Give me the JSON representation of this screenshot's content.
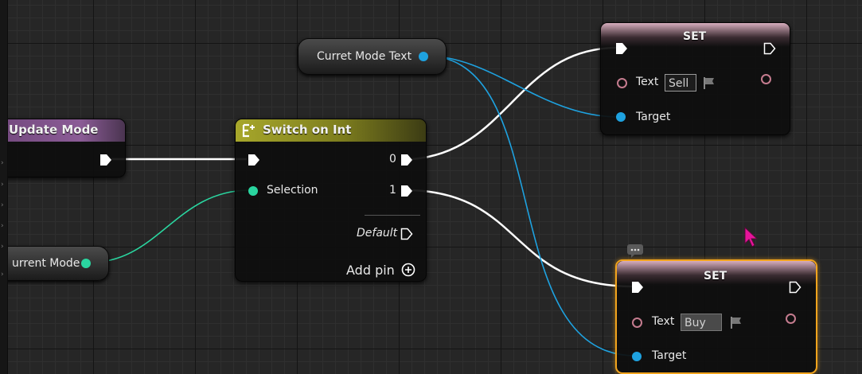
{
  "events": {
    "update_mode": {
      "title": "Update Mode"
    }
  },
  "variables": {
    "current_mode_text": {
      "label": "Curret Mode Text"
    },
    "current_mode": {
      "label": "urrent Mode"
    }
  },
  "switch_node": {
    "title": "Switch on Int",
    "selection_label": "Selection",
    "out_0": "0",
    "out_1": "1",
    "default_label": "Default",
    "add_pin_label": "Add pin"
  },
  "set_nodes": [
    {
      "title": "SET",
      "text_label": "Text",
      "text_value": "Sell",
      "target_label": "Target",
      "selected": false
    },
    {
      "title": "SET",
      "text_label": "Text",
      "text_value": "Buy",
      "target_label": "Target",
      "selected": true
    }
  ],
  "colors": {
    "event_header": "#7b5386",
    "switch_header": "#8f8f22",
    "set_header": "#d2a5b6",
    "exec_wire": "#ffffff",
    "object_wire": "#1ea2e0",
    "int_wire": "#2ad6a0",
    "text_pin": "#c57c8f",
    "selection_outline": "#f2a41d",
    "cursor": "#e6149a"
  },
  "icons": {
    "switch_icon": "switch-icon",
    "add_pin_icon": "plus-circle-icon",
    "bind_flag_icon": "flag-icon",
    "comment_bubble_icon": "comment-bubble-icon",
    "cursor": "mouse-cursor-icon"
  }
}
